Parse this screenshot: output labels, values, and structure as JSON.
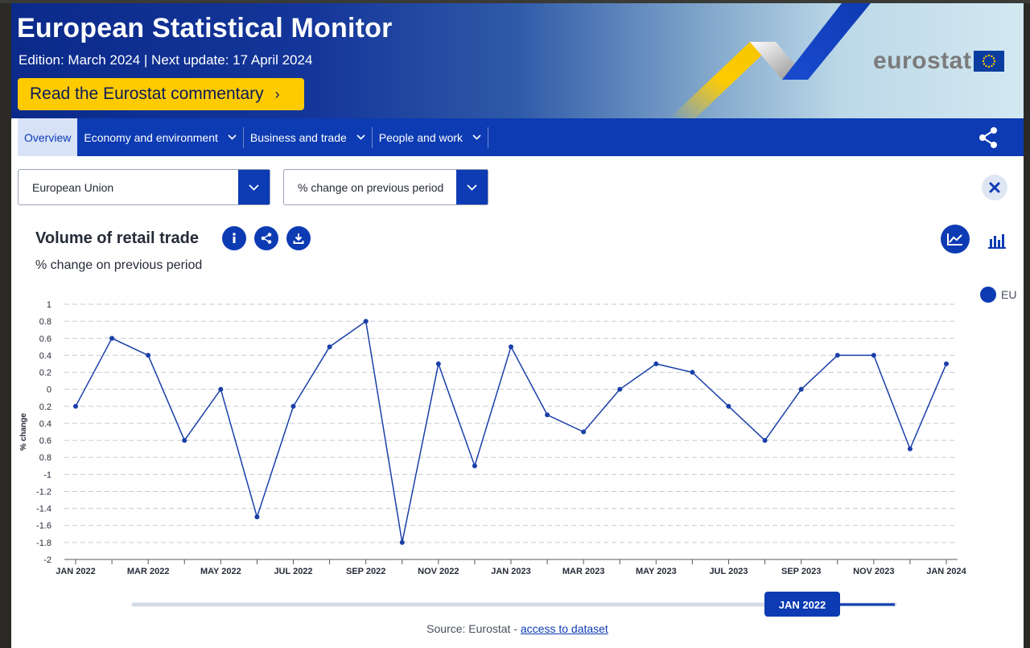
{
  "header": {
    "title": "European Statistical Monitor",
    "edition": "Edition: March 2024 | Next update: 17 April 2024",
    "cta_label": "Read the Eurostat commentary",
    "logo_text": "eurostat"
  },
  "nav": {
    "items": [
      {
        "label": "Overview"
      },
      {
        "label": "Economy and environment"
      },
      {
        "label": "Business and trade"
      },
      {
        "label": "People and work"
      }
    ]
  },
  "filters": {
    "geo": "European Union",
    "unit": "% change on previous period"
  },
  "colors": {
    "brand": "#0d3bb3",
    "accent": "#fecb00",
    "line": "#1a3fa8"
  },
  "icons": {
    "info": "info-icon",
    "share": "share-icon",
    "download": "download-icon",
    "line_chart": "line-chart-icon",
    "bar_chart": "bar-chart-icon",
    "close": "close-icon"
  },
  "chart_data": {
    "type": "line",
    "title": "Volume of retail trade",
    "subtitle": "% change on previous period",
    "ylabel": "% change",
    "xlabel": "",
    "ylim": [
      -2,
      1
    ],
    "yticks": [
      "1",
      "0.8",
      "0.6",
      "0.4",
      "0.2",
      "0",
      "0.2",
      "0.4",
      "0.6",
      "0.8",
      "-1",
      "-1.2",
      "-1.4",
      "-1.6",
      "-1.8",
      "-2"
    ],
    "x_tick_labels": [
      "JAN 2022",
      "MAR 2022",
      "MAY 2022",
      "JUL 2022",
      "SEP 2022",
      "NOV 2022",
      "JAN 2023",
      "MAR 2023",
      "MAY 2023",
      "JUL 2023",
      "SEP 2023",
      "NOV 2023",
      "JAN 2024"
    ],
    "x": [
      "2022-01",
      "2022-02",
      "2022-03",
      "2022-04",
      "2022-05",
      "2022-06",
      "2022-07",
      "2022-08",
      "2022-09",
      "2022-10",
      "2022-11",
      "2022-12",
      "2023-01",
      "2023-02",
      "2023-03",
      "2023-04",
      "2023-05",
      "2023-06",
      "2023-07",
      "2023-08",
      "2023-09",
      "2023-10",
      "2023-11",
      "2023-12",
      "2024-01"
    ],
    "series": [
      {
        "name": "EU",
        "values": [
          -0.2,
          0.6,
          0.4,
          -0.6,
          0.0,
          -1.5,
          -0.2,
          0.5,
          0.8,
          -1.8,
          0.3,
          -0.9,
          0.5,
          -0.3,
          -0.5,
          0.0,
          0.3,
          0.2,
          -0.2,
          -0.6,
          0.0,
          0.4,
          0.4,
          -0.7,
          0.3
        ]
      }
    ],
    "grid": true,
    "legend": "right"
  },
  "timeline": {
    "label": "JAN 2022"
  },
  "source": {
    "prefix": "Source: Eurostat - ",
    "link": "access to dataset"
  }
}
